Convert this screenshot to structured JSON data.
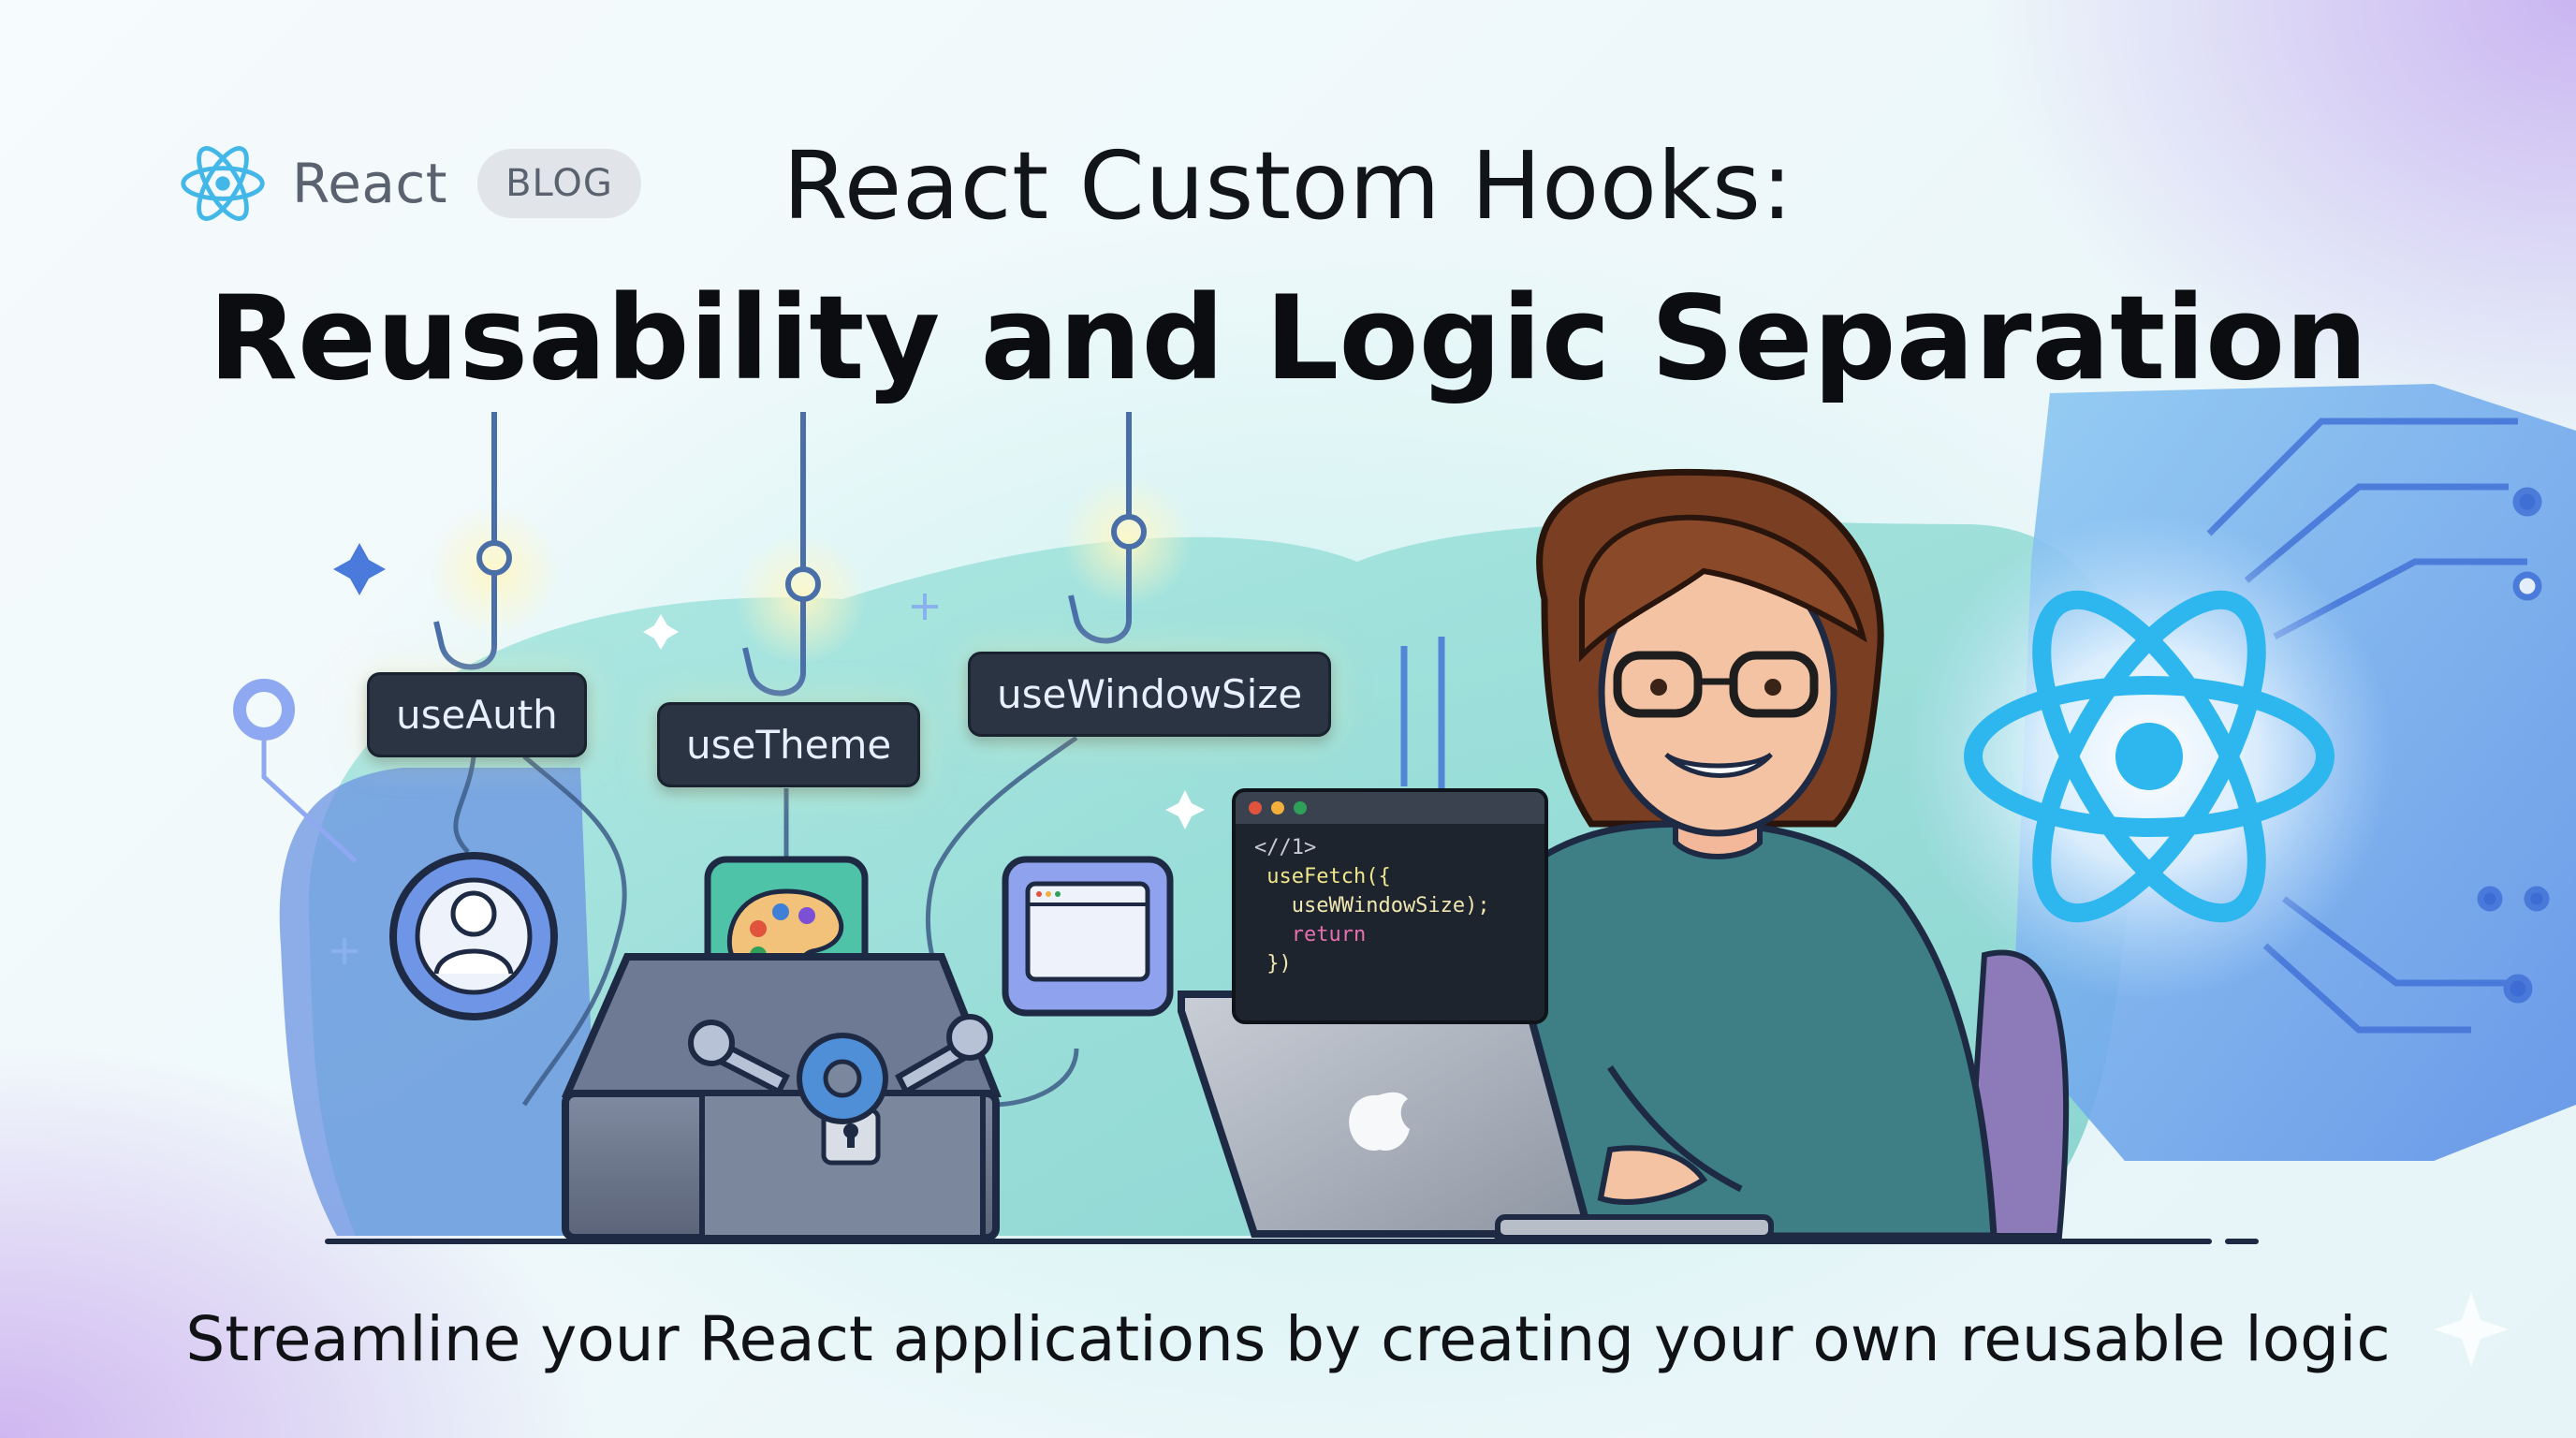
{
  "brand": {
    "name": "React",
    "badge": "BLOG",
    "logo_icon": "react-atom-icon",
    "logo_color": "#43b8e8"
  },
  "title": {
    "line1": "React Custom Hooks:",
    "line2": "Reusability and Logic Separation"
  },
  "subtitle": "Streamline your React applications by creating your own reusable logic",
  "hooks": [
    {
      "label": "useAuth",
      "icon": "user-profile-icon"
    },
    {
      "label": "useTheme",
      "icon": "palette-icon"
    },
    {
      "label": "useWindowSize",
      "icon": "browser-window-icon"
    }
  ],
  "code_window": {
    "lines": [
      "<//1>",
      " useFetch({",
      "   useWWindowSize);",
      "   return",
      " })"
    ]
  },
  "colors": {
    "react_blue": "#36b6ee",
    "label_bg": "#2a3442",
    "teal_blob": "#8fd9d2",
    "blue_hex": "#6aa6ec",
    "sweater": "#3d7f84"
  },
  "icons": [
    "react-atom-icon",
    "fishing-hook-icon",
    "toolbox-icon",
    "gear-icon",
    "wrench-icon",
    "padlock-icon",
    "laptop-icon",
    "apple-logo-icon",
    "sparkle-icon",
    "circuit-icon"
  ]
}
